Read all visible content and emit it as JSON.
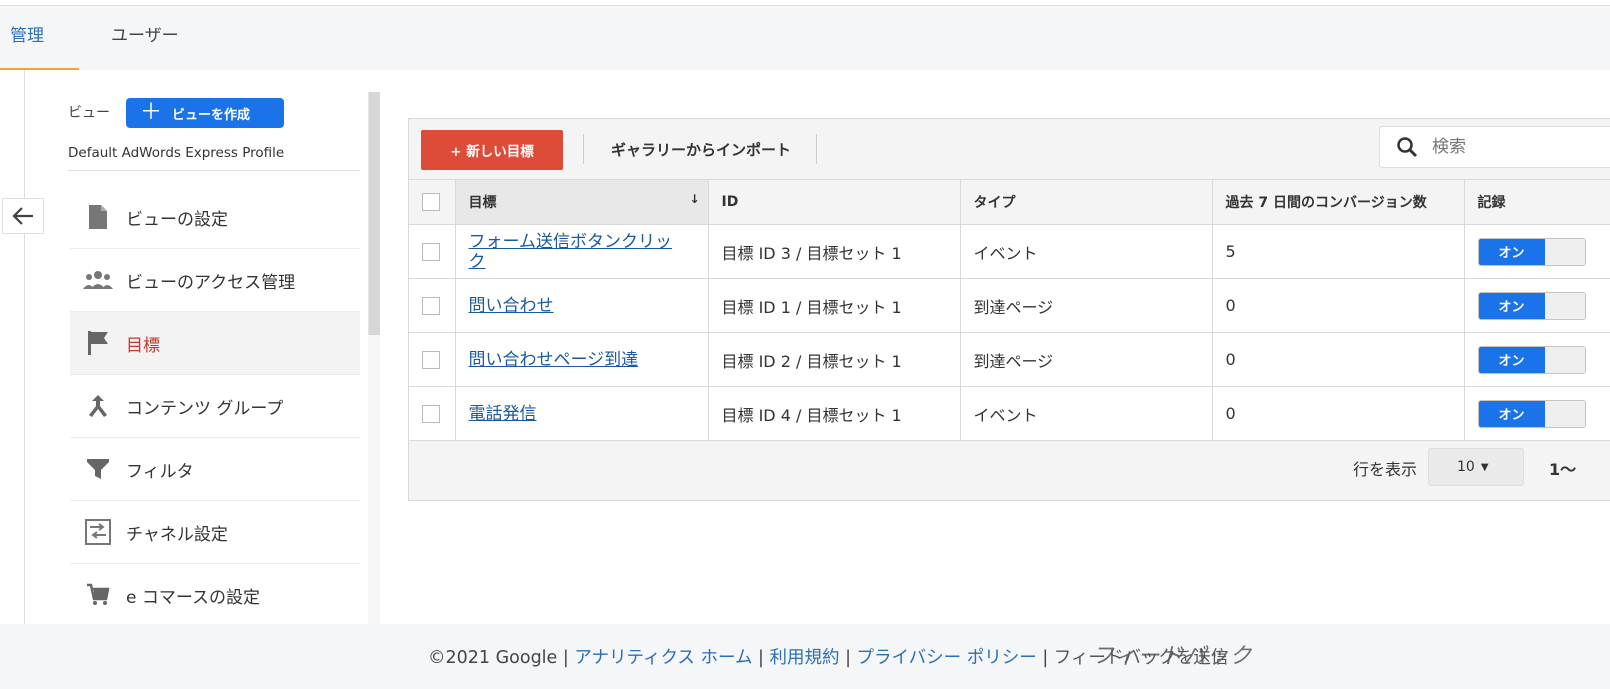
{
  "tabs": [
    {
      "label": "管理"
    },
    {
      "label": "ユーザー"
    }
  ],
  "view": {
    "label": "ビュー",
    "create_button": "ビューを作成",
    "profile_name": "Default AdWords Express Profile"
  },
  "menu": [
    {
      "label": "ビューの設定",
      "icon": "document-icon"
    },
    {
      "label": "ビューのアクセス管理",
      "icon": "people-icon"
    },
    {
      "label": "目標",
      "icon": "flag-icon"
    },
    {
      "label": "コンテンツ グループ",
      "icon": "merge-icon"
    },
    {
      "label": "フィルタ",
      "icon": "filter-icon"
    },
    {
      "label": "チャネル設定",
      "icon": "channel-icon"
    },
    {
      "label": "e コマースの設定",
      "icon": "cart-icon"
    }
  ],
  "toolbar": {
    "new_goal": "+ 新しい目標",
    "import": "ギャラリーからインポート",
    "search_placeholder": "検索"
  },
  "table": {
    "headers": [
      "目標",
      "ID",
      "タイプ",
      "過去 7 日間のコンバージョン数",
      "記録"
    ],
    "rows": [
      {
        "goal": "フォーム送信ボタンクリック",
        "id": "目標 ID 3 / 目標セット 1",
        "type": "イベント",
        "conversions": "5",
        "record": "オン"
      },
      {
        "goal": "問い合わせ",
        "id": "目標 ID 1 / 目標セット 1",
        "type": "到達ページ",
        "conversions": "0",
        "record": "オン"
      },
      {
        "goal": "問い合わせページ到達",
        "id": "目標 ID 2 / 目標セット 1",
        "type": "到達ページ",
        "conversions": "0",
        "record": "オン"
      },
      {
        "goal": "電話発信",
        "id": "目標 ID 4 / 目標セット 1",
        "type": "イベント",
        "conversions": "0",
        "record": "オン"
      }
    ]
  },
  "pager": {
    "rows_label": "行を表示",
    "rows_value": "10",
    "range": "1〜"
  },
  "footer": {
    "copyright": "©2021 Google",
    "link_home": "アナリティクス ホーム",
    "link_terms": "利用規約",
    "link_privacy": "プライバシー ポリシー",
    "feedback": "フィードバックを送信",
    "feedback_overlay": "フィードバック",
    "sep": " | "
  },
  "colors": {
    "accent_blue": "#1a73e8",
    "new_goal_red": "#dd4b39",
    "active_menu_red": "#c0392b",
    "tab_underline": "#f1a33a"
  }
}
